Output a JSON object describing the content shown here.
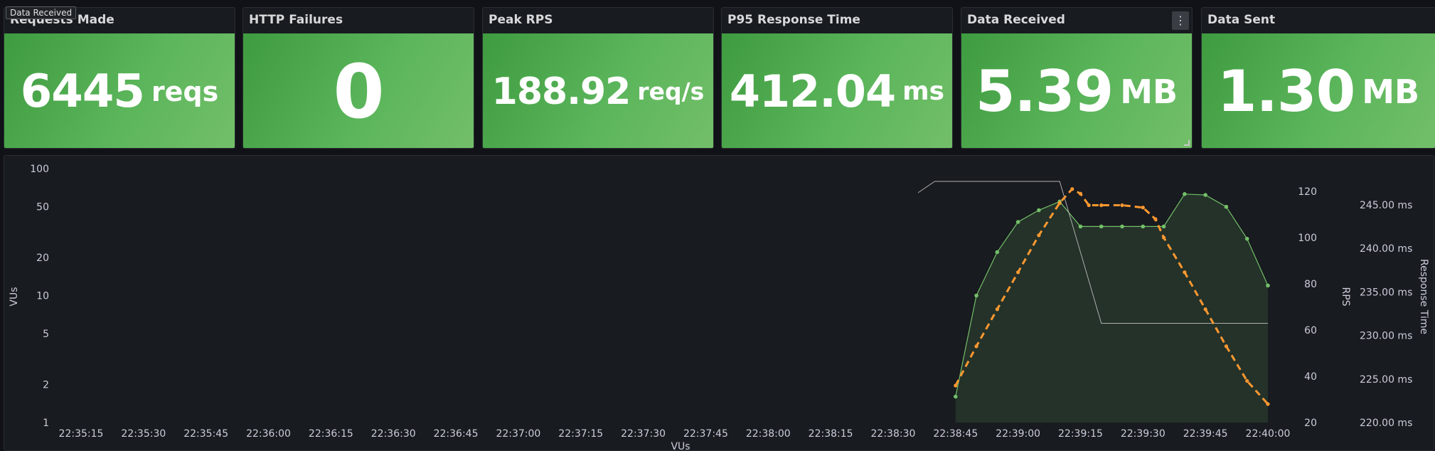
{
  "tooltip": "Data Received",
  "stats": [
    {
      "title": "Requests Made",
      "value": "6445",
      "unit": "reqs"
    },
    {
      "title": "HTTP Failures",
      "value": "0",
      "unit": ""
    },
    {
      "title": "Peak RPS",
      "value": "188.92",
      "unit": "req/s"
    },
    {
      "title": "P95 Response Time",
      "value": "412.04",
      "unit": "ms"
    },
    {
      "title": "Data Received",
      "value": "5.39",
      "unit": "MB"
    },
    {
      "title": "Data Sent",
      "value": "1.30",
      "unit": "MB"
    }
  ],
  "colors": {
    "stat_green": "#5bb55b",
    "vus_line": "#73bf69",
    "rps_line": "#ff9830",
    "response_line": "#b0b0b0",
    "background": "#181b1f"
  },
  "chart_data": {
    "type": "line",
    "xlabel": "VUs",
    "x_ticks": [
      "22:35:15",
      "22:35:30",
      "22:35:45",
      "22:36:00",
      "22:36:15",
      "22:36:30",
      "22:36:45",
      "22:37:00",
      "22:37:15",
      "22:37:30",
      "22:37:45",
      "22:38:00",
      "22:38:15",
      "22:38:30",
      "22:38:45",
      "22:39:00",
      "22:39:15",
      "22:39:30",
      "22:39:45",
      "22:40:00"
    ],
    "y_left": {
      "label": "VUs",
      "scale": "log",
      "ticks": [
        "100",
        "50",
        "20",
        "10",
        "5",
        "2",
        "1"
      ]
    },
    "y_right1": {
      "label": "RPS",
      "ticks": [
        "120",
        "100",
        "80",
        "60",
        "40",
        "20"
      ]
    },
    "y_right2": {
      "label": "Response Time",
      "ticks": [
        "245.00 ms",
        "240.00 ms",
        "235.00 ms",
        "230.00 ms",
        "225.00 ms",
        "220.00 ms"
      ]
    },
    "series": [
      {
        "axis": "left",
        "x": [
          "22:38:45",
          "22:38:50",
          "22:38:55",
          "22:39:00",
          "22:39:05",
          "22:39:10",
          "22:39:15",
          "22:39:20",
          "22:39:25",
          "22:39:30",
          "22:39:35",
          "22:39:40",
          "22:39:45",
          "22:39:50",
          "22:39:55",
          "22:40:00"
        ],
        "values": [
          1.6,
          10,
          22,
          38,
          47,
          55,
          35,
          35,
          35,
          35,
          35,
          63,
          62,
          50,
          28,
          12
        ]
      },
      {
        "axis": "right1",
        "x": [
          "22:38:45",
          "22:38:50",
          "22:38:55",
          "22:39:00",
          "22:39:05",
          "22:39:10",
          "22:39:13",
          "22:39:15",
          "22:39:17",
          "22:39:20",
          "22:39:25",
          "22:39:30",
          "22:39:33",
          "22:39:35",
          "22:39:40",
          "22:39:45",
          "22:39:50",
          "22:39:55",
          "22:40:00"
        ],
        "values": [
          36,
          53,
          69,
          85,
          101,
          115,
          121,
          119,
          114,
          114,
          114,
          113,
          108,
          100,
          85,
          69,
          53,
          38,
          28
        ]
      },
      {
        "axis": "right2",
        "x": [
          "22:38:36",
          "22:38:40",
          "22:39:10",
          "22:39:20",
          "22:40:00"
        ],
        "values": [
          246.4,
          247.7,
          247.7,
          231.4,
          231.4
        ]
      }
    ]
  }
}
